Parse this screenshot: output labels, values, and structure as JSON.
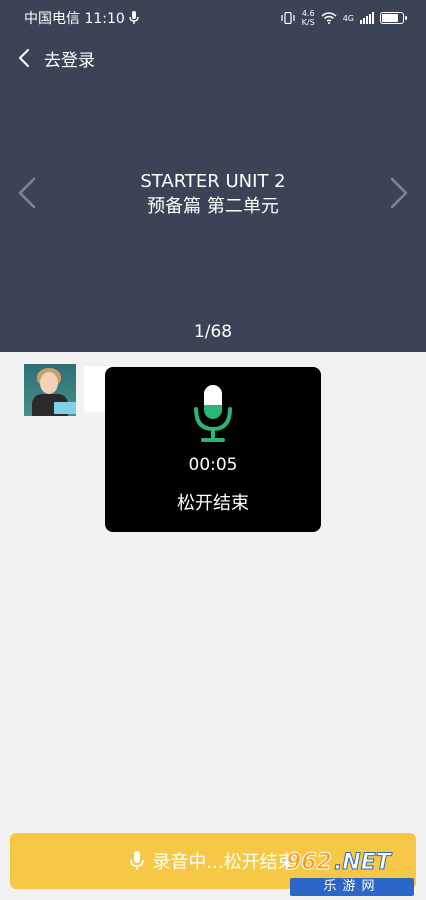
{
  "status_bar": {
    "carrier_time": "中国电信 11:10",
    "net_speed_value": "4.6",
    "net_speed_unit": "K/S",
    "network_type": "4G"
  },
  "nav": {
    "back_label": "去登录"
  },
  "lesson": {
    "title": "STARTER UNIT 2",
    "subtitle": "预备篇 第二单元",
    "page_indicator": "1/68"
  },
  "recording_overlay": {
    "timer": "00:05",
    "hint": "松开结束"
  },
  "record_button": {
    "label": "录音中...松开结束"
  },
  "watermark": {
    "number": "962",
    "domain": ".NET",
    "site_name": "乐游网"
  },
  "colors": {
    "header_bg": "#3a4456",
    "accent_green": "#2bb673",
    "record_button_bg": "#f6c845"
  }
}
